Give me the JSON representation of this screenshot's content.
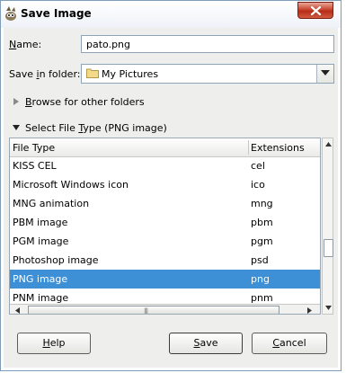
{
  "window": {
    "title": "Save Image"
  },
  "form": {
    "name_label_u": "N",
    "name_label_rest": "ame:",
    "name_value": "pato.png",
    "folder_label_pre": "Save ",
    "folder_label_u": "i",
    "folder_label_rest": "n folder:",
    "folder_value": "My Pictures",
    "browse_label_pre": "",
    "browse_label_u": "B",
    "browse_label_rest": "rowse for other folders",
    "filetype_label_pre": "Select File ",
    "filetype_label_u": "T",
    "filetype_label_rest": "ype (PNG image)"
  },
  "list": {
    "columns": [
      "File Type",
      "Extensions"
    ],
    "rows": [
      {
        "type": "KISS CEL",
        "ext": "cel"
      },
      {
        "type": "Microsoft Windows icon",
        "ext": "ico"
      },
      {
        "type": "MNG animation",
        "ext": "mng"
      },
      {
        "type": "PBM image",
        "ext": "pbm"
      },
      {
        "type": "PGM image",
        "ext": "pgm"
      },
      {
        "type": "Photoshop image",
        "ext": "psd"
      },
      {
        "type": "PNG image",
        "ext": "png"
      },
      {
        "type": "PNM image",
        "ext": "pnm"
      }
    ],
    "selected_index": 6
  },
  "buttons": {
    "help_u": "H",
    "help_rest": "elp",
    "save_u": "S",
    "save_rest": "ave",
    "cancel_u": "C",
    "cancel_rest": "ancel"
  },
  "colors": {
    "selection": "#3d8fd6",
    "close_button": "#c8452f"
  },
  "icons": {
    "app": "gimp-icon",
    "close": "close-icon",
    "folder": "folder-icon",
    "combo": "chevron-down-icon"
  }
}
